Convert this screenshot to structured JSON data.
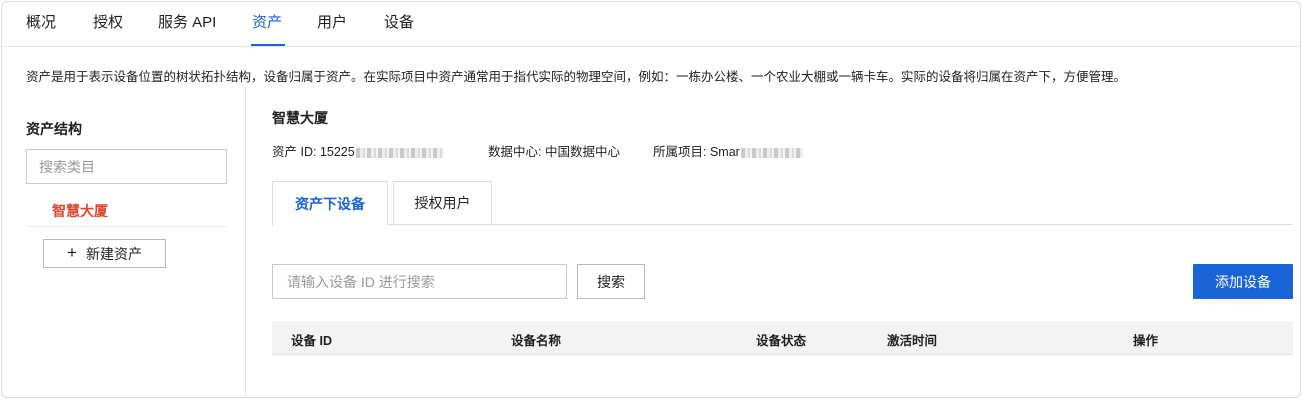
{
  "nav": {
    "tabs": [
      {
        "label": "概况"
      },
      {
        "label": "授权"
      },
      {
        "label": "服务 API"
      },
      {
        "label": "资产"
      },
      {
        "label": "用户"
      },
      {
        "label": "设备"
      }
    ],
    "active": "资产"
  },
  "description": "资产是用于表示设备位置的树状拓扑结构，设备归属于资产。在实际项目中资产通常用于指代实际的物理空间，例如：一栋办公楼、一个农业大棚或一辆卡车。实际的设备将归属在资产下，方便管理。",
  "left_panel": {
    "title": "资产结构",
    "search_placeholder": "搜索类目",
    "tree": [
      {
        "label": "智慧大厦",
        "selected": true
      }
    ],
    "new_asset_label": "新建资产",
    "new_asset_icon": "plus-icon"
  },
  "asset": {
    "name": "智慧大厦",
    "id_label": "资产 ID: ",
    "id_value": "15225",
    "datacenter_label": "数据中心: ",
    "datacenter_value": "中国数据中心",
    "project_label": "所属项目: ",
    "project_value": "Smar"
  },
  "tabs": [
    {
      "label": "资产下设备",
      "active": true
    },
    {
      "label": "授权用户",
      "active": false
    }
  ],
  "device_search": {
    "placeholder": "请输入设备 ID 进行搜索",
    "search_label": "搜索",
    "add_label": "添加设备"
  },
  "table": {
    "columns": [
      "设备 ID",
      "设备名称",
      "设备状态",
      "激活时间",
      "操作"
    ],
    "rows": []
  },
  "colors": {
    "accent": "#1a64d8",
    "selected_node": "#e0442c",
    "table_header_bg": "#f3f3f3"
  }
}
